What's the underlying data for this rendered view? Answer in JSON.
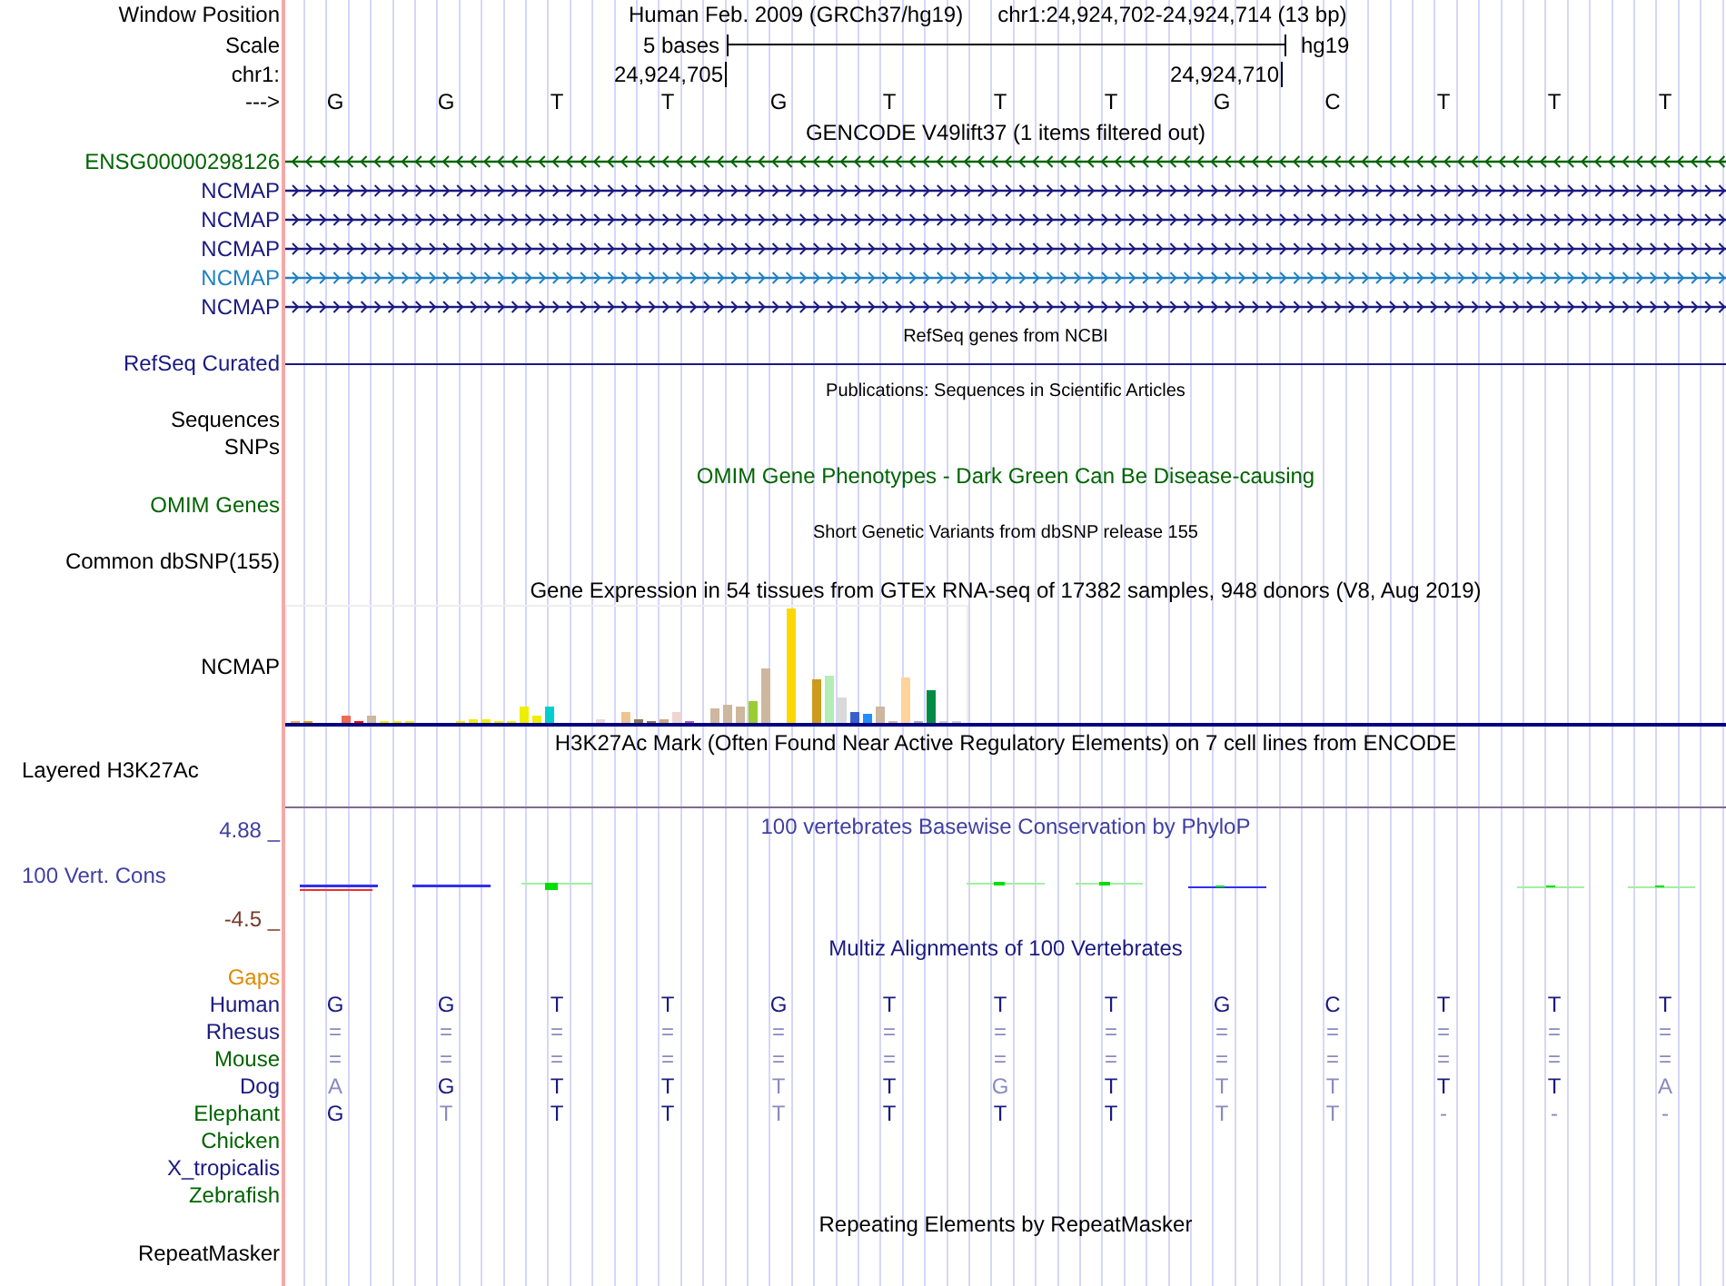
{
  "header": {
    "label": "Window Position",
    "assembly": "Human Feb. 2009 (GRCh37/hg19)",
    "position": "chr1:24,924,702-24,924,714 (13 bp)"
  },
  "scale": {
    "label": "Scale",
    "span": "5 bases",
    "assembly": "hg19"
  },
  "ruler": {
    "label": "chr1:",
    "ticks": [
      "24,924,705",
      "24,924,710"
    ]
  },
  "sequence": {
    "label": "--->",
    "bases": [
      "G",
      "G",
      "T",
      "T",
      "G",
      "T",
      "T",
      "T",
      "G",
      "C",
      "T",
      "T",
      "T"
    ]
  },
  "tracks": [
    {
      "kind": "title",
      "text": "GENCODE V49lift37 (1 items filtered out)",
      "color": "#000000"
    },
    {
      "kind": "gene",
      "label": "ENSG00000298126",
      "color": "#006400",
      "reverse": true
    },
    {
      "kind": "gene",
      "label": "NCMAP",
      "color": "#1a1a80",
      "reverse": false
    },
    {
      "kind": "gene",
      "label": "NCMAP",
      "color": "#1a1a80",
      "reverse": false
    },
    {
      "kind": "gene",
      "label": "NCMAP",
      "color": "#1a1a80",
      "reverse": false
    },
    {
      "kind": "gene",
      "label": "NCMAP",
      "color": "#2080c0",
      "reverse": false
    },
    {
      "kind": "gene",
      "label": "NCMAP",
      "color": "#1a1a80",
      "reverse": false
    },
    {
      "kind": "note",
      "text": "RefSeq genes from NCBI"
    },
    {
      "kind": "line",
      "label": "RefSeq Curated",
      "color": "#1a1a80"
    },
    {
      "kind": "note",
      "text": "Publications: Sequences in Scientific Articles"
    },
    {
      "kind": "label",
      "label": "Sequences",
      "color": "#000000"
    },
    {
      "kind": "label",
      "label": "SNPs",
      "color": "#000000"
    },
    {
      "kind": "title",
      "text": "OMIM Gene Phenotypes - Dark Green Can Be Disease-causing",
      "color": "#006400"
    },
    {
      "kind": "label",
      "label": "OMIM Genes",
      "color": "#006400"
    },
    {
      "kind": "note",
      "text": "Short Genetic Variants from dbSNP release 155"
    },
    {
      "kind": "label",
      "label": "Common dbSNP(155)",
      "color": "#000000"
    },
    {
      "kind": "title",
      "text": "Gene Expression in 54 tissues from GTEx RNA-seq of 17382 samples, 948 donors (V8, Aug 2019)",
      "color": "#000000"
    },
    {
      "kind": "bars",
      "label": "NCMAP",
      "color": "#000000"
    },
    {
      "kind": "title",
      "text": "H3K27Ac Mark (Often Found Near Active Regulatory Elements) on 7 cell lines from ENCODE",
      "color": "#000000"
    },
    {
      "kind": "layered",
      "label": "Layered H3K27Ac",
      "color": "#000000"
    },
    {
      "kind": "wiggle",
      "max": "4.88 _",
      "label": "100 Vert. Cons",
      "min": "-4.5 _",
      "title": "100 vertebrates Basewise Conservation by PhyloP",
      "color": "#4040a0"
    },
    {
      "kind": "title",
      "text": "Multiz Alignments of 100 Vertebrates",
      "color": "#1a1a80"
    },
    {
      "kind": "label",
      "label": "Gaps",
      "color": "#e08a00"
    },
    {
      "kind": "species",
      "label": "Human",
      "color": "#1a1a80",
      "cells": [
        {
          "text": "G",
          "faint": false
        },
        {
          "text": "G",
          "faint": false
        },
        {
          "text": "T",
          "faint": false
        },
        {
          "text": "T",
          "faint": false
        },
        {
          "text": "G",
          "faint": false
        },
        {
          "text": "T",
          "faint": false
        },
        {
          "text": "T",
          "faint": false
        },
        {
          "text": "T",
          "faint": false
        },
        {
          "text": "G",
          "faint": false
        },
        {
          "text": "C",
          "faint": false
        },
        {
          "text": "T",
          "faint": false
        },
        {
          "text": "T",
          "faint": false
        },
        {
          "text": "T",
          "faint": false
        }
      ]
    },
    {
      "kind": "species",
      "label": "Rhesus",
      "color": "#1a1a80",
      "cells": [
        {
          "text": "=",
          "faint": true
        },
        {
          "text": "=",
          "faint": true
        },
        {
          "text": "=",
          "faint": true
        },
        {
          "text": "=",
          "faint": true
        },
        {
          "text": "=",
          "faint": true
        },
        {
          "text": "=",
          "faint": true
        },
        {
          "text": "=",
          "faint": true
        },
        {
          "text": "=",
          "faint": true
        },
        {
          "text": "=",
          "faint": true
        },
        {
          "text": "=",
          "faint": true
        },
        {
          "text": "=",
          "faint": true
        },
        {
          "text": "=",
          "faint": true
        },
        {
          "text": "=",
          "faint": true
        }
      ]
    },
    {
      "kind": "species",
      "label": "Mouse",
      "color": "#006400",
      "cells": [
        {
          "text": "=",
          "faint": true
        },
        {
          "text": "=",
          "faint": true
        },
        {
          "text": "=",
          "faint": true
        },
        {
          "text": "=",
          "faint": true
        },
        {
          "text": "=",
          "faint": true
        },
        {
          "text": "=",
          "faint": true
        },
        {
          "text": "=",
          "faint": true
        },
        {
          "text": "=",
          "faint": true
        },
        {
          "text": "=",
          "faint": true
        },
        {
          "text": "=",
          "faint": true
        },
        {
          "text": "=",
          "faint": true
        },
        {
          "text": "=",
          "faint": true
        },
        {
          "text": "=",
          "faint": true
        }
      ]
    },
    {
      "kind": "species",
      "label": "Dog",
      "color": "#1a1a80",
      "cells": [
        {
          "text": "A",
          "faint": true
        },
        {
          "text": "G",
          "faint": false
        },
        {
          "text": "T",
          "faint": false
        },
        {
          "text": "T",
          "faint": false
        },
        {
          "text": "T",
          "faint": true
        },
        {
          "text": "T",
          "faint": false
        },
        {
          "text": "G",
          "faint": true
        },
        {
          "text": "T",
          "faint": false
        },
        {
          "text": "T",
          "faint": true
        },
        {
          "text": "T",
          "faint": true
        },
        {
          "text": "T",
          "faint": false
        },
        {
          "text": "T",
          "faint": false
        },
        {
          "text": "A",
          "faint": true
        }
      ]
    },
    {
      "kind": "species",
      "label": "Elephant",
      "color": "#006400",
      "cells": [
        {
          "text": "G",
          "faint": false
        },
        {
          "text": "T",
          "faint": true
        },
        {
          "text": "T",
          "faint": false
        },
        {
          "text": "T",
          "faint": false
        },
        {
          "text": "T",
          "faint": true
        },
        {
          "text": "T",
          "faint": false
        },
        {
          "text": "T",
          "faint": false
        },
        {
          "text": "T",
          "faint": false
        },
        {
          "text": "T",
          "faint": true
        },
        {
          "text": "T",
          "faint": true
        },
        {
          "text": "-",
          "faint": true
        },
        {
          "text": "-",
          "faint": true
        },
        {
          "text": "-",
          "faint": true
        }
      ]
    },
    {
      "kind": "species",
      "label": "Chicken",
      "color": "#006400"
    },
    {
      "kind": "species",
      "label": "X_tropicalis",
      "color": "#1a1a80"
    },
    {
      "kind": "species",
      "label": "Zebrafish",
      "color": "#006400"
    },
    {
      "kind": "title",
      "text": "Repeating Elements by RepeatMasker",
      "color": "#000000"
    },
    {
      "kind": "label",
      "label": "RepeatMasker",
      "color": "#000000"
    }
  ]
}
